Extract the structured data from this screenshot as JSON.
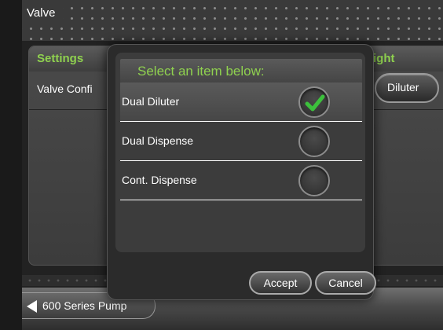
{
  "header": {
    "title": "Valve"
  },
  "panel": {
    "settings_label": "Settings",
    "right_label": "ight",
    "row_label": "Valve Confi",
    "diluter_button": "Diluter"
  },
  "footer": {
    "back_label": "600 Series Pump"
  },
  "dialog": {
    "title": "Select an item below:",
    "options": [
      {
        "label": "Dual Diluter",
        "selected": true
      },
      {
        "label": "Dual Dispense",
        "selected": false
      },
      {
        "label": "Cont. Dispense",
        "selected": false
      }
    ],
    "accept_label": "Accept",
    "cancel_label": "Cancel"
  },
  "colors": {
    "accent_green": "#8fd14f",
    "check_green": "#3cc03c"
  },
  "icons": {
    "selected": "checkmark-icon",
    "back": "left-arrow-icon"
  }
}
